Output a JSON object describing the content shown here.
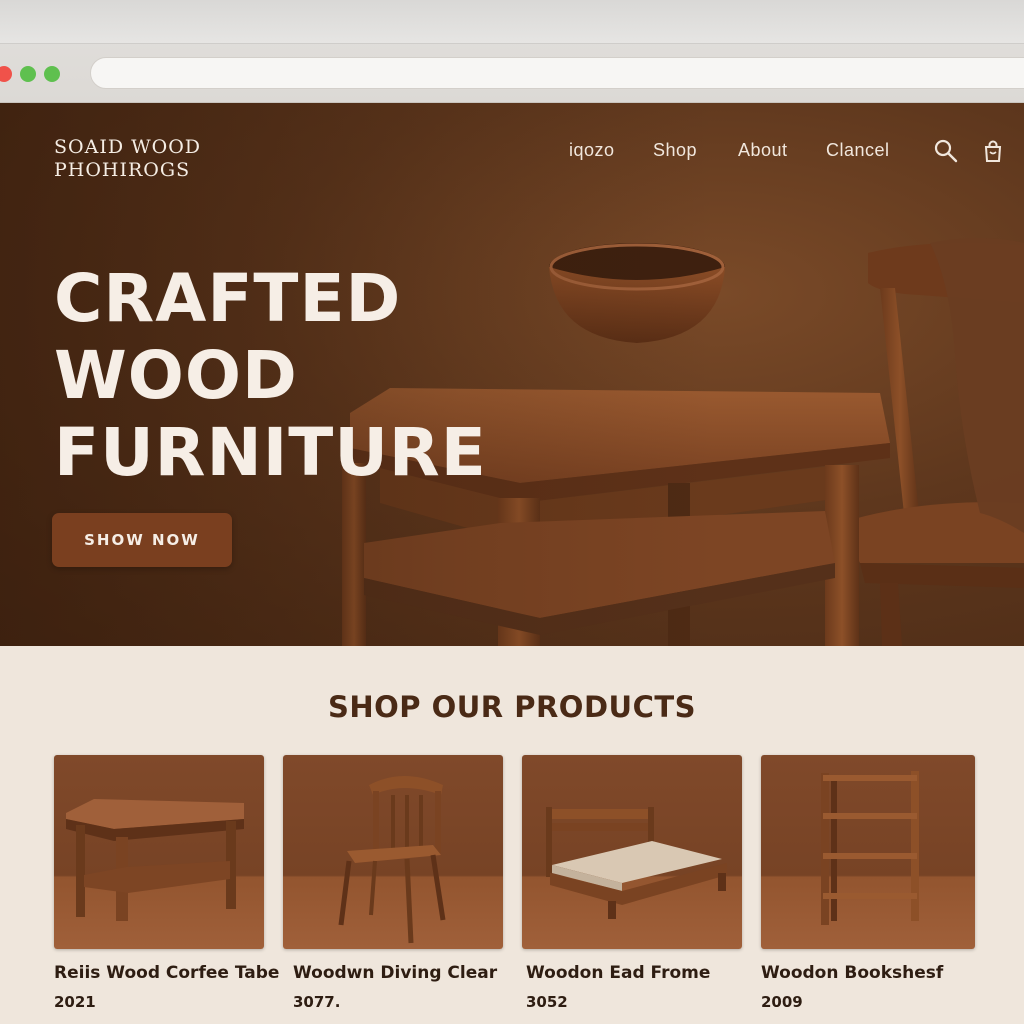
{
  "browser": {
    "controls": [
      "close-dot",
      "minimize-dot",
      "maximize-dot"
    ],
    "url": ""
  },
  "header": {
    "brand_line1": "SOAID WOOD",
    "brand_line2": "PHOHIROGS",
    "nav": [
      "iqozo",
      "Shop",
      "About",
      "Clancel"
    ],
    "icons": [
      "search-icon",
      "shopping-bag-icon"
    ]
  },
  "hero": {
    "title_lines": [
      "CRAFTED",
      "WOOD",
      "FURNITURE"
    ],
    "cta_label": "SHOW NOW"
  },
  "products": {
    "section_title": "SHOP OUR PRODUCTS",
    "items": [
      {
        "name": "Reiis Wood Corfee Tabe",
        "price": "2021"
      },
      {
        "name": "Woodwn Diving Clear",
        "price": "3077."
      },
      {
        "name": "Woodon Ead Frome",
        "price": "3052"
      },
      {
        "name": "Woodon Bookshesf",
        "price": "2009"
      }
    ]
  },
  "colors": {
    "hero_bg": "#5e371d",
    "cta_bg": "#7a3f1f",
    "page_bg": "#efe6dc",
    "heading_text": "#4a2a16",
    "light_text": "#f6eee6"
  }
}
